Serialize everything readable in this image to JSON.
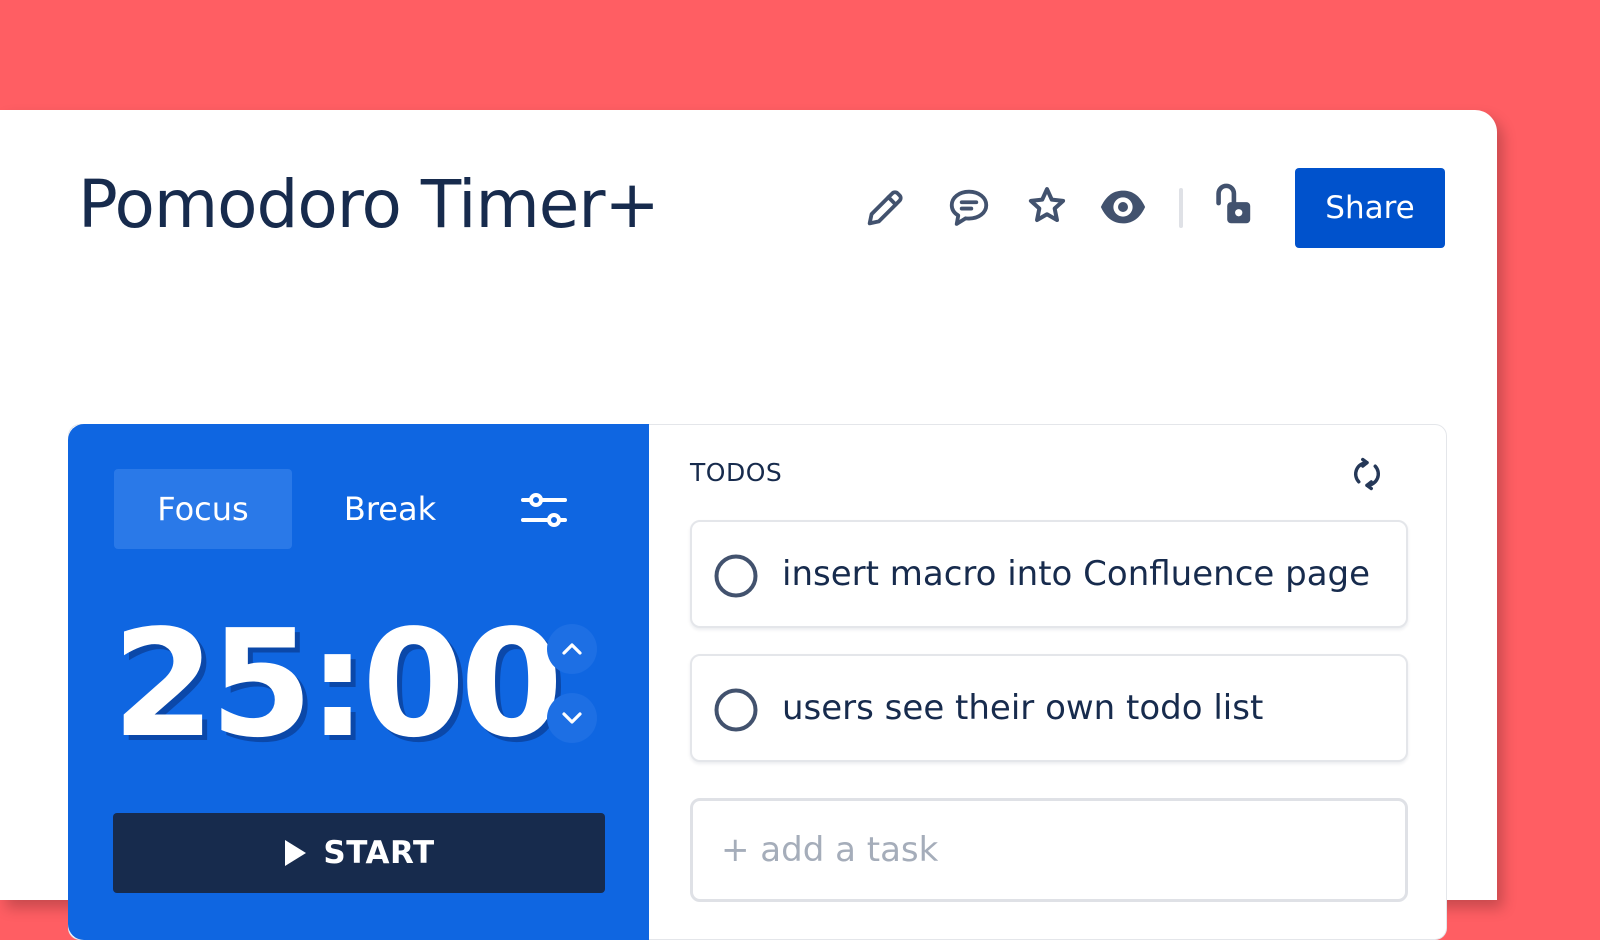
{
  "page": {
    "title": "Pomodoro Timer+",
    "background_color": "#FF5E63"
  },
  "toolbar": {
    "icons": [
      "edit-icon",
      "comment-icon",
      "star-icon",
      "watch-icon",
      "unlocked-icon"
    ],
    "share_label": "Share",
    "share_color": "#0052CC"
  },
  "timer": {
    "panel_color": "#0F66E1",
    "tabs": [
      {
        "label": "Focus",
        "active": true
      },
      {
        "label": "Break",
        "active": false
      }
    ],
    "time": "25:00",
    "start_label": "START",
    "start_color": "#172B4D"
  },
  "todos": {
    "header": "TODOS",
    "items": [
      {
        "text": "insert macro into Confluence page",
        "done": false
      },
      {
        "text": "users see their own todo list",
        "done": false
      }
    ],
    "add_placeholder": "+ add a task"
  }
}
